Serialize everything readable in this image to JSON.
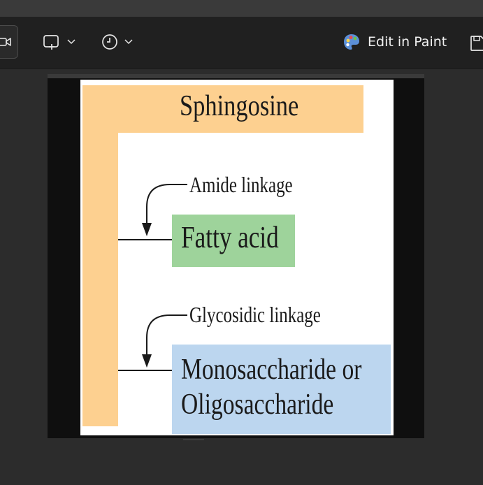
{
  "toolbar": {
    "edit_in_paint_label": "Edit in Paint"
  },
  "diagram": {
    "title": "Sphingosine",
    "amide_label": "Amide linkage",
    "fatty_acid_label": "Fatty acid",
    "glycosidic_label": "Glycosidic linkage",
    "sugar_line1": "Monosaccharide or",
    "sugar_line2": "Oligosaccharide"
  },
  "colors": {
    "sphingosine_bar": "#fdd090",
    "fatty_acid_box": "#9ed39b",
    "sugar_box": "#bcd6ef"
  }
}
